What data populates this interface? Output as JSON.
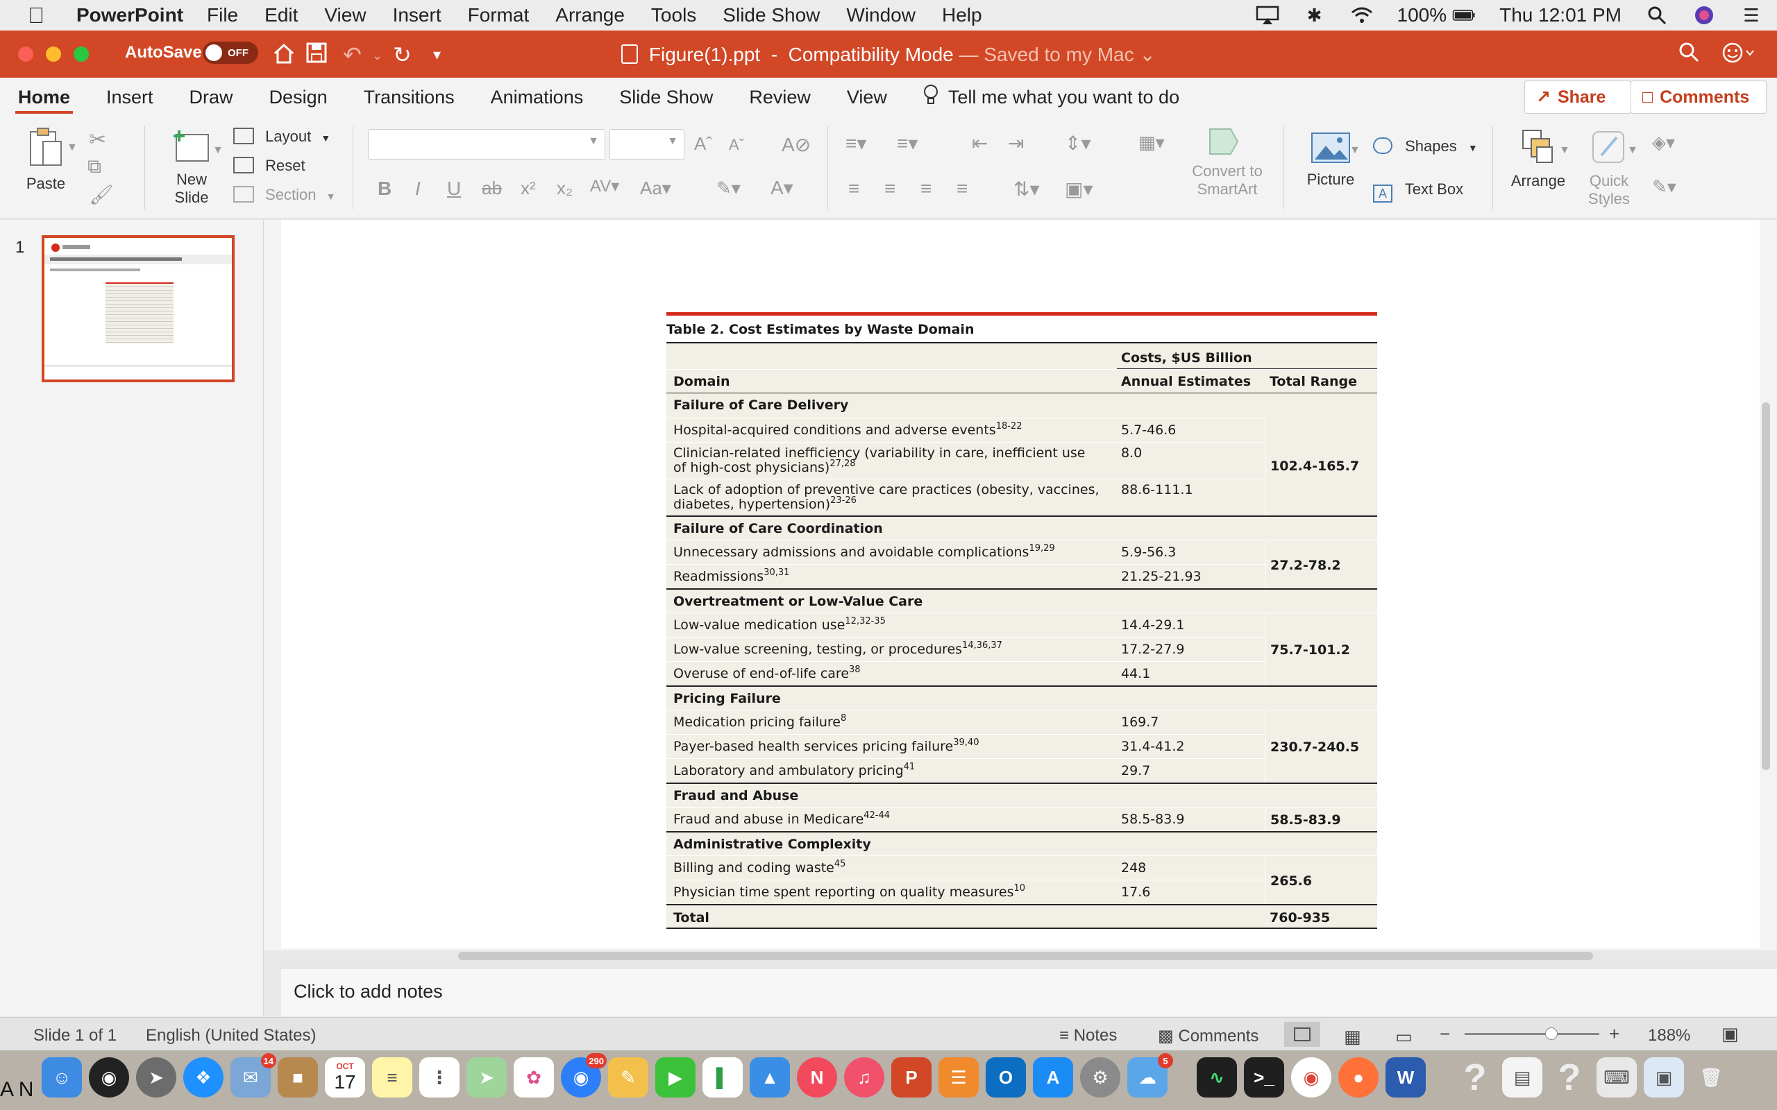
{
  "menubar": {
    "app": "PowerPoint",
    "items": [
      "File",
      "Edit",
      "View",
      "Insert",
      "Format",
      "Arrange",
      "Tools",
      "Slide Show",
      "Window",
      "Help"
    ],
    "battery": "100%",
    "clock": "Thu 12:01 PM"
  },
  "titlebar": {
    "autosave": "AutoSave",
    "toggle": "OFF",
    "filename": "Figure(1).ppt",
    "mode": "Compatibility Mode",
    "saved": "— Saved to my Mac"
  },
  "tabs": {
    "items": [
      "Home",
      "Insert",
      "Draw",
      "Design",
      "Transitions",
      "Animations",
      "Slide Show",
      "Review",
      "View"
    ],
    "tell_me": "Tell me what you want to do",
    "share": "Share",
    "comments": "Comments"
  },
  "ribbon": {
    "paste": "Paste",
    "new_slide_1": "New",
    "new_slide_2": "Slide",
    "layout": "Layout",
    "reset": "Reset",
    "section": "Section",
    "convert_1": "Convert to",
    "convert_2": "SmartArt",
    "picture": "Picture",
    "shapes": "Shapes",
    "text_box": "Text Box",
    "arrange": "Arrange",
    "quick_1": "Quick",
    "quick_2": "Styles"
  },
  "thumbnail": {
    "number": "1"
  },
  "table": {
    "caption": "Table 2. Cost Estimates by Waste Domain",
    "head_costs": "Costs, $US Billion",
    "col_domain": "Domain",
    "col_annual": "Annual Estimates",
    "col_total": "Total Range",
    "total_label": "Total",
    "total_value": "760-935",
    "domains": [
      {
        "name": "Failure of Care Delivery",
        "range": "102.4-165.7",
        "items": [
          {
            "text": "Hospital-acquired conditions and adverse events",
            "ref": "18-22",
            "value": "5.7-46.6"
          },
          {
            "text": "Clinician-related inefficiency (variability in care, inefficient use",
            "text2": "of high-cost physicians)",
            "ref": "27,28",
            "value": "8.0"
          },
          {
            "text": "Lack of adoption of preventive care practices (obesity, vaccines,",
            "text2": "diabetes, hypertension)",
            "ref": "23-26",
            "value": "88.6-111.1"
          }
        ]
      },
      {
        "name": "Failure of Care Coordination",
        "range": "27.2-78.2",
        "items": [
          {
            "text": "Unnecessary admissions and avoidable complications",
            "ref": "19,29",
            "value": "5.9-56.3"
          },
          {
            "text": "Readmissions",
            "ref": "30,31",
            "value": "21.25-21.93"
          }
        ]
      },
      {
        "name": "Overtreatment or Low-Value Care",
        "range": "75.7-101.2",
        "items": [
          {
            "text": "Low-value medication use",
            "ref": "12,32-35",
            "value": "14.4-29.1"
          },
          {
            "text": "Low-value screening, testing, or procedures",
            "ref": "14,36,37",
            "value": "17.2-27.9"
          },
          {
            "text": "Overuse of end-of-life care",
            "ref": "38",
            "value": "44.1"
          }
        ]
      },
      {
        "name": "Pricing Failure",
        "range": "230.7-240.5",
        "items": [
          {
            "text": "Medication pricing failure",
            "ref": "8",
            "value": "169.7"
          },
          {
            "text": "Payer-based health services pricing failure",
            "ref": "39,40",
            "value": "31.4-41.2"
          },
          {
            "text": "Laboratory and ambulatory pricing",
            "ref": "41",
            "value": "29.7"
          }
        ]
      },
      {
        "name": "Fraud and Abuse",
        "range": "58.5-83.9",
        "items": [
          {
            "text": "Fraud and abuse in Medicare",
            "ref": "42-44",
            "value": "58.5-83.9"
          }
        ]
      },
      {
        "name": "Administrative Complexity",
        "range": "265.6",
        "items": [
          {
            "text": "Billing and coding waste",
            "ref": "45",
            "value": "248"
          },
          {
            "text": "Physician time spent reporting on quality measures",
            "ref": "10",
            "value": "17.6"
          }
        ]
      }
    ]
  },
  "notes": {
    "placeholder": "Click to add notes"
  },
  "status": {
    "slide": "Slide 1 of 1",
    "language": "English (United States)",
    "notes": "Notes",
    "comments": "Comments",
    "zoom": "188%"
  },
  "dock": {
    "left_text": "A N",
    "badge_mail": "14",
    "badge_messages": "290",
    "badge_other": "5",
    "calendar_month": "OCT",
    "calendar_day": "17"
  }
}
